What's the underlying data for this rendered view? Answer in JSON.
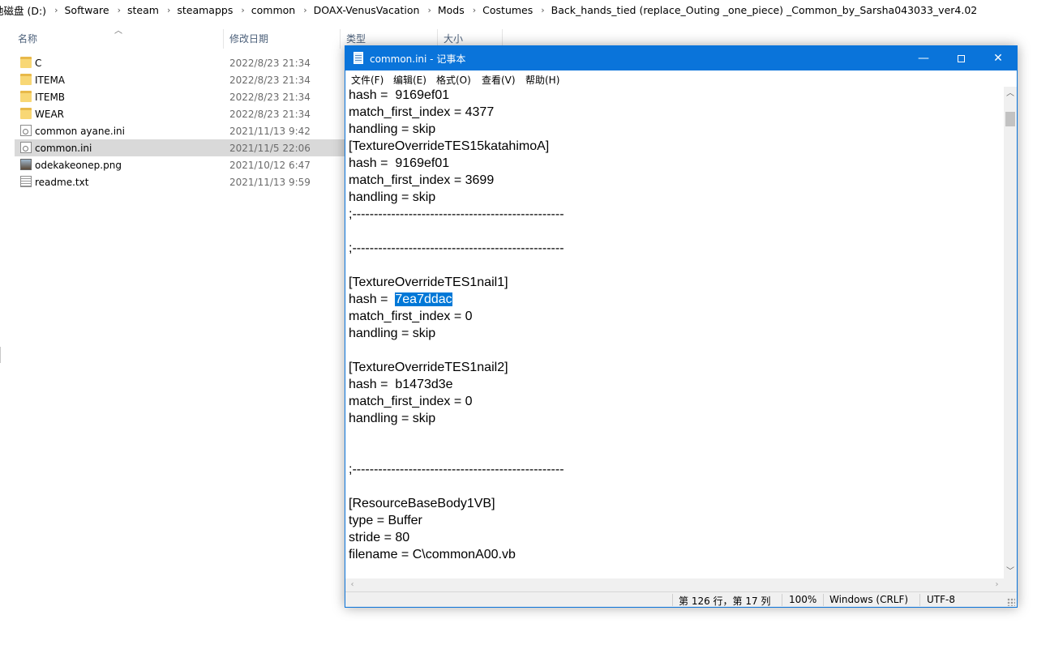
{
  "explorer": {
    "breadcrumb": [
      "地磁盘 (D:)",
      "Software",
      "steam",
      "steamapps",
      "common",
      "DOAX-VenusVacation",
      "Mods",
      "Costumes",
      "Back_hands_tied (replace_Outing _one_piece) _Common_by_Sarsha043033_ver4.02"
    ],
    "columns": {
      "name": "名称",
      "date": "修改日期",
      "type": "类型",
      "size": "大小"
    },
    "files": [
      {
        "name": "C",
        "date": "2022/8/23 21:34",
        "icon": "folder-icon"
      },
      {
        "name": "ITEMA",
        "date": "2022/8/23 21:34",
        "icon": "folder-icon"
      },
      {
        "name": "ITEMB",
        "date": "2022/8/23 21:34",
        "icon": "folder-icon"
      },
      {
        "name": "WEAR",
        "date": "2022/8/23 21:34",
        "icon": "folder-icon"
      },
      {
        "name": "common ayane.ini",
        "date": "2021/11/13 9:42",
        "icon": "ini-file-icon"
      },
      {
        "name": "common.ini",
        "date": "2021/11/5 22:06",
        "icon": "ini-file-icon",
        "selected": true
      },
      {
        "name": "odekakeonep.png",
        "date": "2021/10/12 6:47",
        "icon": "image-file-icon"
      },
      {
        "name": "readme.txt",
        "date": "2021/11/13 9:59",
        "icon": "text-file-icon"
      }
    ]
  },
  "notepad": {
    "title": "common.ini - 记事本",
    "buttons": {
      "minimize": "—",
      "close": "✕"
    },
    "menu": [
      "文件(F)",
      "编辑(E)",
      "格式(O)",
      "查看(V)",
      "帮助(H)"
    ],
    "lines": [
      "hash =  9169ef01",
      "match_first_index = 4377",
      "handling = skip",
      "[TextureOverrideTES15katahimoA]",
      "hash =  9169ef01",
      "match_first_index = 3699",
      "handling = skip",
      ";-------------------------------------------------",
      "",
      ";-------------------------------------------------",
      "",
      "[TextureOverrideTES1nail1]",
      "hash =  ",
      "match_first_index = 0",
      "handling = skip",
      "",
      "[TextureOverrideTES1nail2]",
      "hash =  b1473d3e",
      "match_first_index = 0",
      "handling = skip",
      "",
      "",
      ";-------------------------------------------------",
      "",
      "[ResourceBaseBody1VB]",
      "type = Buffer",
      "stride = 80",
      "filename = C\\commonA00.vb"
    ],
    "selected_text": "7ea7ddac",
    "status": {
      "position": "第 126 行，第 17 列",
      "zoom": "100%",
      "line_ending": "Windows (CRLF)",
      "encoding": "UTF-8"
    }
  }
}
